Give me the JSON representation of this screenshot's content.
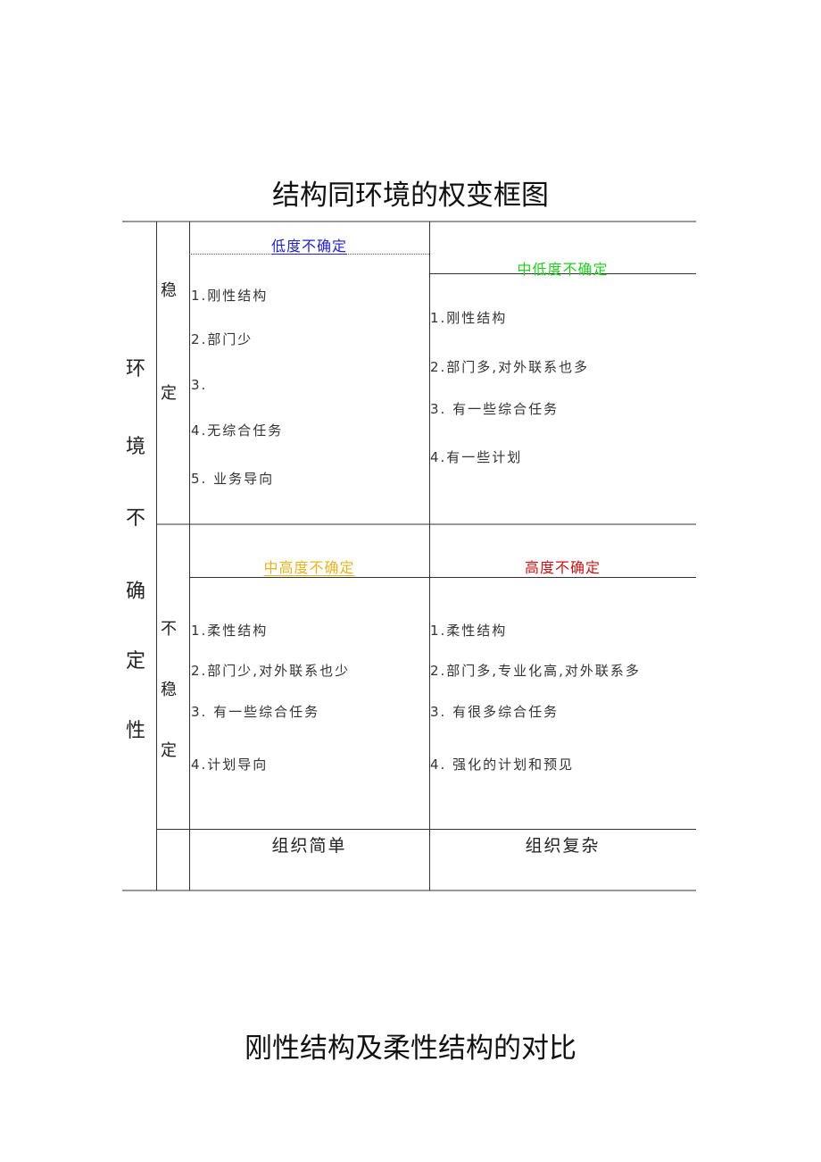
{
  "document": {
    "title": "结构同环境的权变框图",
    "subtitle": "刚性结构及柔性结构的对比"
  },
  "matrix": {
    "row_axis_label": [
      "环",
      "境",
      "不",
      "确",
      "定",
      "性"
    ],
    "rows": [
      {
        "label": [
          "稳",
          "定"
        ]
      },
      {
        "label": [
          "不",
          "稳",
          "定"
        ]
      }
    ],
    "quadrants": {
      "stable_simple": {
        "heading": "低度不确定",
        "heading_color": "#2222cc",
        "items": [
          "1.刚性结构",
          "2.部门少",
          "3.",
          "4.无综合任务",
          "5. 业务导向"
        ]
      },
      "stable_complex": {
        "heading": "中低度不确定",
        "heading_color": "#22cc22",
        "items": [
          "1.刚性结构",
          "2.部门多,对外联系也多",
          "3. 有一些综合任务",
          "4.有一些计划"
        ]
      },
      "unstable_simple": {
        "heading": "中高度不确定",
        "heading_color": "#e6b422",
        "items": [
          "1.柔性结构",
          "2.部门少,对外联系也少",
          "3. 有一些综合任务",
          "4.计划导向"
        ]
      },
      "unstable_complex": {
        "heading": "高度不确定",
        "heading_color": "#cc1111",
        "items": [
          "1.柔性结构",
          "2.部门多,专业化高,对外联系多",
          "3. 有很多综合任务",
          "4. 强化的计划和预见"
        ]
      }
    },
    "columns": [
      "组织简单",
      "组织复杂"
    ]
  }
}
